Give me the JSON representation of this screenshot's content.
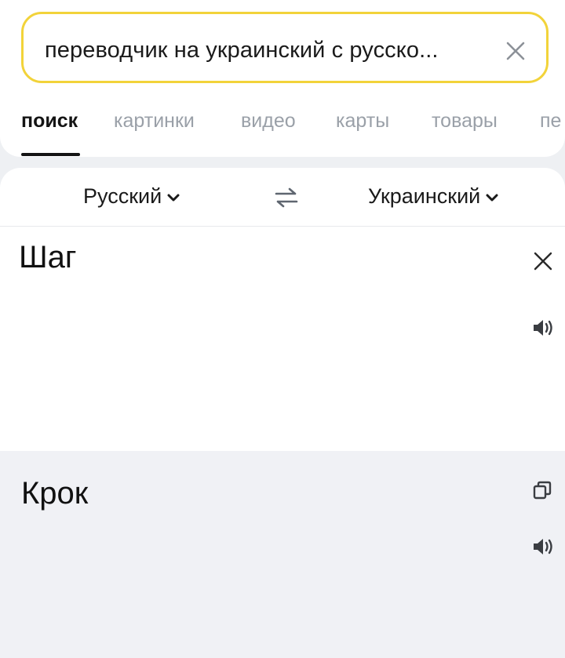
{
  "search": {
    "query": "переводчик на украинский с русско..."
  },
  "tabs": [
    {
      "label": "поиск",
      "active": true
    },
    {
      "label": "картинки",
      "active": false
    },
    {
      "label": "видео",
      "active": false
    },
    {
      "label": "карты",
      "active": false
    },
    {
      "label": "товары",
      "active": false
    },
    {
      "label": "пе",
      "active": false
    }
  ],
  "translator": {
    "source_lang": "Русский",
    "target_lang": "Украинский",
    "source_text": "Шаг",
    "result_text": "Крок"
  },
  "icons": {
    "clear_search": "close-icon",
    "swap": "swap-arrows-icon",
    "clear_input": "close-icon",
    "speaker": "speaker-icon",
    "copy": "copy-icon",
    "chevron": "chevron-down-icon"
  },
  "colors": {
    "accent_border": "#f2d33a",
    "inactive_tab": "#9aa0a8",
    "result_background": "#f0f1f5"
  }
}
